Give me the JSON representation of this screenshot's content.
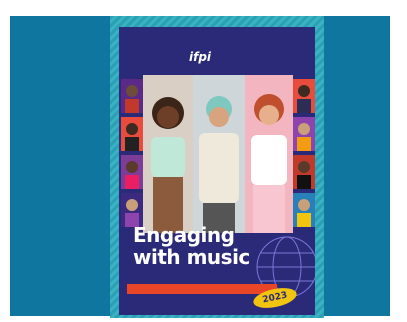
{
  "image": {
    "description_colors": {
      "frame_bg": "#0f76a0",
      "cover_border": "#39b3c4",
      "cover_bg": "#2b2a78",
      "title_accent": "#e84626",
      "badge": "#f1c40f"
    }
  },
  "cover": {
    "logo_text": "ifpi",
    "logo_subtitle": "",
    "title_line1": "Engaging",
    "title_line2": "with music",
    "year": "2023"
  }
}
